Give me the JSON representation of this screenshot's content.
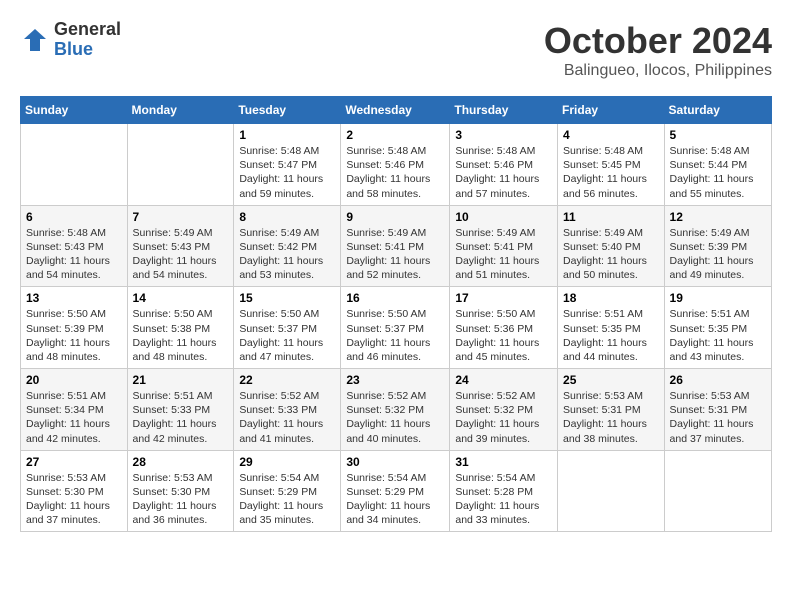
{
  "logo": {
    "general": "General",
    "blue": "Blue"
  },
  "title": "October 2024",
  "location": "Balingueo, Ilocos, Philippines",
  "weekdays": [
    "Sunday",
    "Monday",
    "Tuesday",
    "Wednesday",
    "Thursday",
    "Friday",
    "Saturday"
  ],
  "weeks": [
    [
      {
        "day": "",
        "info": ""
      },
      {
        "day": "",
        "info": ""
      },
      {
        "day": "1",
        "info": "Sunrise: 5:48 AM\nSunset: 5:47 PM\nDaylight: 11 hours and 59 minutes."
      },
      {
        "day": "2",
        "info": "Sunrise: 5:48 AM\nSunset: 5:46 PM\nDaylight: 11 hours and 58 minutes."
      },
      {
        "day": "3",
        "info": "Sunrise: 5:48 AM\nSunset: 5:46 PM\nDaylight: 11 hours and 57 minutes."
      },
      {
        "day": "4",
        "info": "Sunrise: 5:48 AM\nSunset: 5:45 PM\nDaylight: 11 hours and 56 minutes."
      },
      {
        "day": "5",
        "info": "Sunrise: 5:48 AM\nSunset: 5:44 PM\nDaylight: 11 hours and 55 minutes."
      }
    ],
    [
      {
        "day": "6",
        "info": "Sunrise: 5:48 AM\nSunset: 5:43 PM\nDaylight: 11 hours and 54 minutes."
      },
      {
        "day": "7",
        "info": "Sunrise: 5:49 AM\nSunset: 5:43 PM\nDaylight: 11 hours and 54 minutes."
      },
      {
        "day": "8",
        "info": "Sunrise: 5:49 AM\nSunset: 5:42 PM\nDaylight: 11 hours and 53 minutes."
      },
      {
        "day": "9",
        "info": "Sunrise: 5:49 AM\nSunset: 5:41 PM\nDaylight: 11 hours and 52 minutes."
      },
      {
        "day": "10",
        "info": "Sunrise: 5:49 AM\nSunset: 5:41 PM\nDaylight: 11 hours and 51 minutes."
      },
      {
        "day": "11",
        "info": "Sunrise: 5:49 AM\nSunset: 5:40 PM\nDaylight: 11 hours and 50 minutes."
      },
      {
        "day": "12",
        "info": "Sunrise: 5:49 AM\nSunset: 5:39 PM\nDaylight: 11 hours and 49 minutes."
      }
    ],
    [
      {
        "day": "13",
        "info": "Sunrise: 5:50 AM\nSunset: 5:39 PM\nDaylight: 11 hours and 48 minutes."
      },
      {
        "day": "14",
        "info": "Sunrise: 5:50 AM\nSunset: 5:38 PM\nDaylight: 11 hours and 48 minutes."
      },
      {
        "day": "15",
        "info": "Sunrise: 5:50 AM\nSunset: 5:37 PM\nDaylight: 11 hours and 47 minutes."
      },
      {
        "day": "16",
        "info": "Sunrise: 5:50 AM\nSunset: 5:37 PM\nDaylight: 11 hours and 46 minutes."
      },
      {
        "day": "17",
        "info": "Sunrise: 5:50 AM\nSunset: 5:36 PM\nDaylight: 11 hours and 45 minutes."
      },
      {
        "day": "18",
        "info": "Sunrise: 5:51 AM\nSunset: 5:35 PM\nDaylight: 11 hours and 44 minutes."
      },
      {
        "day": "19",
        "info": "Sunrise: 5:51 AM\nSunset: 5:35 PM\nDaylight: 11 hours and 43 minutes."
      }
    ],
    [
      {
        "day": "20",
        "info": "Sunrise: 5:51 AM\nSunset: 5:34 PM\nDaylight: 11 hours and 42 minutes."
      },
      {
        "day": "21",
        "info": "Sunrise: 5:51 AM\nSunset: 5:33 PM\nDaylight: 11 hours and 42 minutes."
      },
      {
        "day": "22",
        "info": "Sunrise: 5:52 AM\nSunset: 5:33 PM\nDaylight: 11 hours and 41 minutes."
      },
      {
        "day": "23",
        "info": "Sunrise: 5:52 AM\nSunset: 5:32 PM\nDaylight: 11 hours and 40 minutes."
      },
      {
        "day": "24",
        "info": "Sunrise: 5:52 AM\nSunset: 5:32 PM\nDaylight: 11 hours and 39 minutes."
      },
      {
        "day": "25",
        "info": "Sunrise: 5:53 AM\nSunset: 5:31 PM\nDaylight: 11 hours and 38 minutes."
      },
      {
        "day": "26",
        "info": "Sunrise: 5:53 AM\nSunset: 5:31 PM\nDaylight: 11 hours and 37 minutes."
      }
    ],
    [
      {
        "day": "27",
        "info": "Sunrise: 5:53 AM\nSunset: 5:30 PM\nDaylight: 11 hours and 37 minutes."
      },
      {
        "day": "28",
        "info": "Sunrise: 5:53 AM\nSunset: 5:30 PM\nDaylight: 11 hours and 36 minutes."
      },
      {
        "day": "29",
        "info": "Sunrise: 5:54 AM\nSunset: 5:29 PM\nDaylight: 11 hours and 35 minutes."
      },
      {
        "day": "30",
        "info": "Sunrise: 5:54 AM\nSunset: 5:29 PM\nDaylight: 11 hours and 34 minutes."
      },
      {
        "day": "31",
        "info": "Sunrise: 5:54 AM\nSunset: 5:28 PM\nDaylight: 11 hours and 33 minutes."
      },
      {
        "day": "",
        "info": ""
      },
      {
        "day": "",
        "info": ""
      }
    ]
  ]
}
